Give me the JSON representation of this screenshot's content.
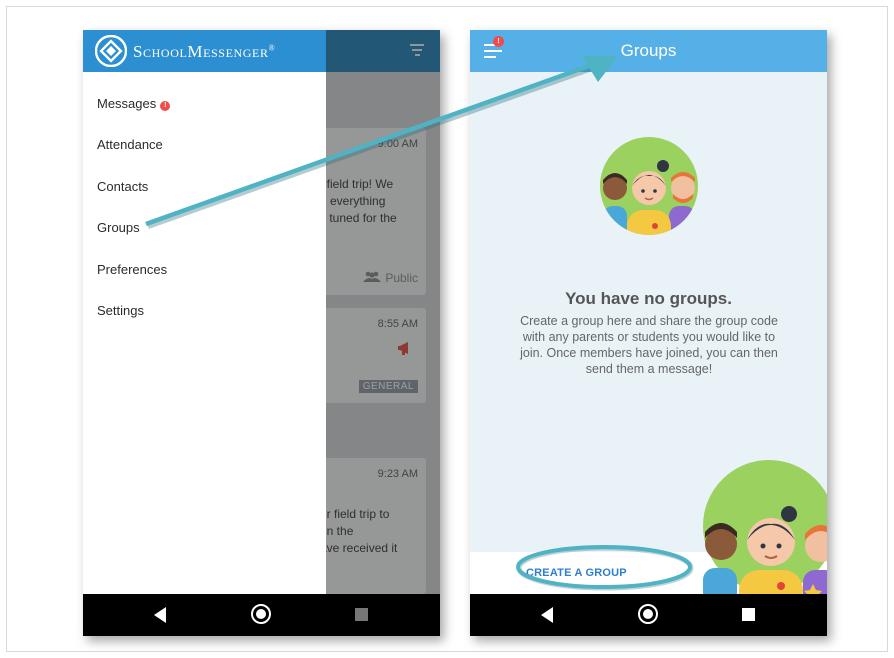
{
  "left_phone": {
    "brand": "SchoolMessenger",
    "brand_mark": "®",
    "menu": [
      {
        "label": "Messages",
        "badge": "!"
      },
      {
        "label": "Attendance"
      },
      {
        "label": "Contacts"
      },
      {
        "label": "Groups"
      },
      {
        "label": "Preferences"
      },
      {
        "label": "Settings"
      }
    ],
    "bg_cards": [
      {
        "time": "9:00 AM",
        "body": "t field trip! We\ne everything\ny tuned for the",
        "footer": "Public"
      },
      {
        "time": "8:55 AM",
        "badge": "GENERAL"
      },
      {
        "time": "9:23 AM",
        "body": "ur field trip to\ngn the\nave received it"
      }
    ]
  },
  "right_phone": {
    "title": "Groups",
    "menu_badge": "!",
    "empty_title": "You have no groups.",
    "empty_desc": "Create a group here and share the group code with any parents or students you would like to join. Once members have joined, you can then send them a message!",
    "create_button": "CREATE A GROUP"
  },
  "colors": {
    "drawer_header": "#2c8fd2",
    "app_header": "#55b0e8",
    "annotation_teal": "#4fb3c4",
    "badge_red": "#ef4d4d"
  },
  "icons": [
    "schoolmessenger-logo-icon",
    "filter-icon",
    "megaphone-icon",
    "people-icon",
    "menu-icon",
    "back-icon",
    "home-icon",
    "recents-icon"
  ]
}
